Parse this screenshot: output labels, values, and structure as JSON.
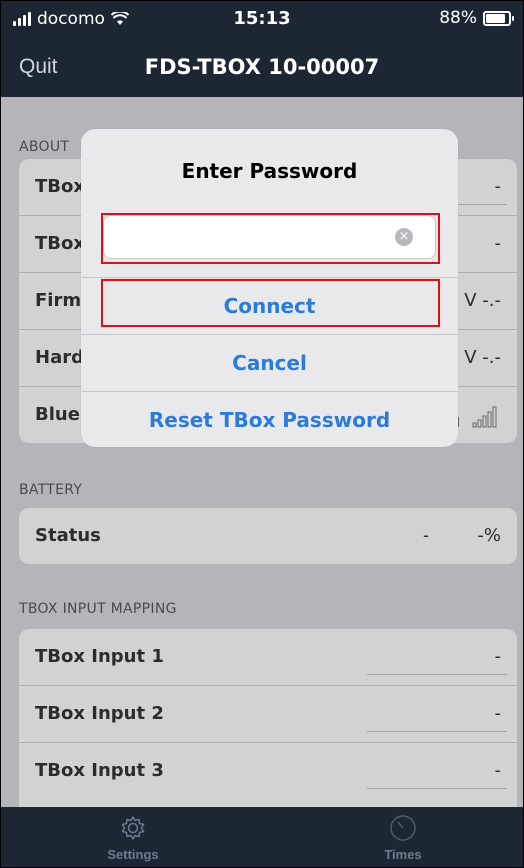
{
  "status_bar": {
    "carrier": "docomo",
    "time": "15:13",
    "battery": "88%"
  },
  "nav": {
    "quit_label": "Quit",
    "title": "FDS-TBOX 10-00007"
  },
  "about": {
    "header": "ABOUT",
    "rows": [
      {
        "label": "TBox",
        "value": "-"
      },
      {
        "label": "TBox",
        "value": "-"
      },
      {
        "label": "Firm",
        "value": "V -.-"
      },
      {
        "label": "Hard",
        "value": "V -.-"
      },
      {
        "label": "Blue",
        "value": ""
      }
    ]
  },
  "battery": {
    "header": "BATTERY",
    "status_label": "Status",
    "status_value": "-",
    "percent": "-%"
  },
  "mapping": {
    "header": "TBOX INPUT MAPPING",
    "rows": [
      {
        "label": "TBox Input 1",
        "value": "-"
      },
      {
        "label": "TBox Input 2",
        "value": "-"
      },
      {
        "label": "TBox Input 3",
        "value": "-"
      }
    ]
  },
  "tabs": {
    "settings": "Settings",
    "times": "Times"
  },
  "dialog": {
    "title": "Enter Password",
    "password_value": "",
    "password_placeholder": "",
    "connect_label": "Connect",
    "cancel_label": "Cancel",
    "reset_label": "Reset TBox Password"
  },
  "colors": {
    "nav_bg": "#1c2733",
    "accent": "#2b7bd9",
    "highlight": "#e01010"
  }
}
